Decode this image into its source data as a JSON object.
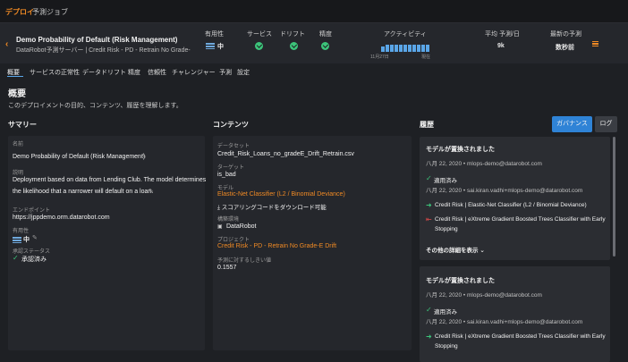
{
  "topnav": {
    "item0": "デプロイ",
    "item1": "予測ジョブ"
  },
  "header": {
    "back_icon": "chevron-left-icon",
    "title": "Demo Probability of Default (Risk Management)",
    "subtitle": "DataRobot予測サーバー | Credit Risk - PD - Retrain No Grade-E…",
    "columns": {
      "usefulness": "有用性",
      "service": "サービス",
      "drift": "ドリフト",
      "accuracy": "精度",
      "activity": "アクティビティ",
      "avg_pred": "平均 予測/日",
      "latest_pred": "最新の予測"
    },
    "usefulness_value": "中",
    "activity_from": "11月27日",
    "activity_to": "現在",
    "activity_bars": [
      0.6,
      0.8,
      0.8,
      0.8,
      0.8,
      0.8,
      0.8,
      0.8,
      0.8,
      0.8,
      0.8
    ],
    "avg_pred_value": "9k",
    "latest_pred_value": "数秒前",
    "status_color": "#3cc47a",
    "accent": "#f08a24"
  },
  "tabs": [
    "概要",
    "サービスの正常性",
    "データドリフト",
    "精度",
    "信頼性",
    "チャレンジャー",
    "予測",
    "設定"
  ],
  "page": {
    "title": "概要",
    "description": "このデプロイメントの目的、コンテンツ、履歴を理解します。"
  },
  "summary": {
    "title": "サマリー",
    "name_label": "名前",
    "name_value": "Demo Probability of Default (Risk Management)",
    "desc_label": "説明",
    "desc_line1": "Deployment based on data from Lending Club. The model determines",
    "desc_line2": "the likelihood that a narrower will default on a loan.",
    "endpoint_label": "エンドポイント",
    "endpoint_value": "https://jppdemo.orm.datarobot.com",
    "importance_label": "有用性",
    "importance_value": "中",
    "approval_label": "承認ステータス",
    "approval_value": "承認済み"
  },
  "contents": {
    "title": "コンテンツ",
    "dataset_label": "データセット",
    "dataset_value": "Credit_Risk_Loans_no_gradeE_Drift_Retrain.csv",
    "target_label": "ターゲット",
    "target_value": "is_bad",
    "model_label": "モデル",
    "model_value": "Elastic-Net Classifier (L2 / Binomial Deviance)",
    "download_label": "スコアリングコードをダウンロード可能",
    "env_label": "構築環境",
    "env_value": "DataRobot",
    "project_label": "プロジェクト",
    "project_value": "Credit Risk - PD - Retrain No Grade-E Drift",
    "threshold_label": "予測に対するしきい値",
    "threshold_value": "0.1557"
  },
  "history": {
    "title": "履歴",
    "governance_button": "ガバナンス",
    "log_button": "ログ",
    "card1": {
      "title": "モデルが置換されました",
      "meta1": "八月 22, 2020 • mlops-demo@datarobot.com",
      "approved": "適用済み",
      "meta2": "八月 22, 2020 • sai.kiran.vadhi+mlops-demo@datarobot.com",
      "in_model": "Credit Risk | Elastic-Net Classifier (L2 / Binomial Deviance)",
      "out_model_line1": "Credit Risk | eXtreme Gradient Boosted Trees Classifier with Early",
      "out_model_line2": "Stopping",
      "more_link": "その他の詳細を表示"
    },
    "card2": {
      "title": "モデルが置換されました",
      "meta1": "八月 22, 2020 • mlops-demo@datarobot.com",
      "approved": "適用済み",
      "meta2": "八月 22, 2020 • sai.kiran.vadhi+mlops-demo@datarobot.com",
      "in_model_line1": "Credit Risk | eXtreme Gradient Boosted Trees Classifier with Early",
      "in_model_line2": "Stopping"
    }
  }
}
